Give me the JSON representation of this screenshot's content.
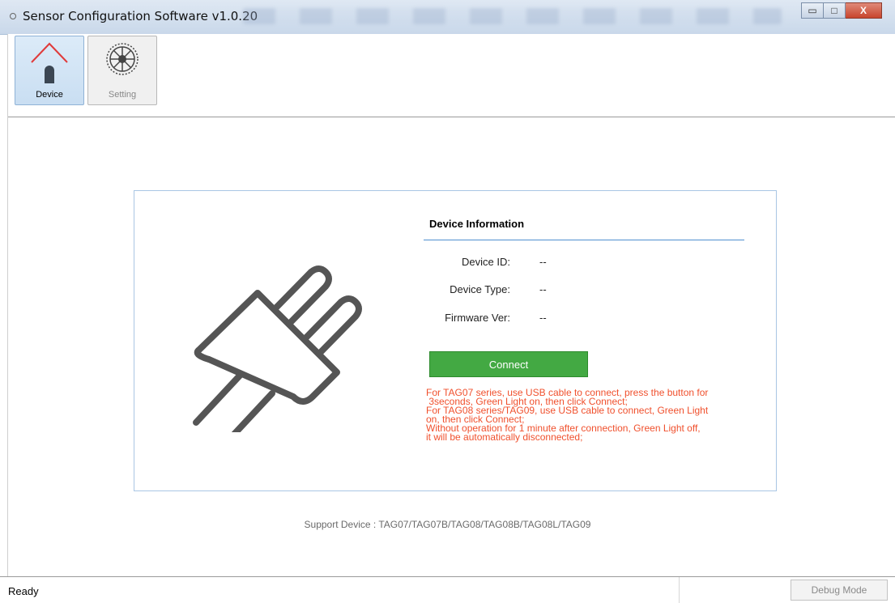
{
  "window": {
    "title": "Sensor Configuration Software v1.0.20",
    "minimize_label": "▭",
    "maximize_label": "□",
    "close_label": "X"
  },
  "toolbar": {
    "items": [
      {
        "label": "Device",
        "icon": "home-icon",
        "selected": true
      },
      {
        "label": "Setting",
        "icon": "gear-icon",
        "selected": false
      }
    ]
  },
  "device_info": {
    "title": "Device Information",
    "rows": [
      {
        "label": "Device ID:",
        "value": "--"
      },
      {
        "label": "Device Type:",
        "value": "--"
      },
      {
        "label": "Firmware Ver:",
        "value": "--"
      }
    ],
    "connect_label": "Connect",
    "notes": [
      "For TAG07 series, use USB cable to connect, press the button for",
      " 3seconds, Green Light on, then click Connect;",
      "For TAG08 series/TAG09, use USB cable to connect, Green Light",
      "on, then click Connect;",
      "Without operation for 1 minute after connection, Green Light off,",
      "it will be automatically disconnected;"
    ]
  },
  "support_text": "Support Device : TAG07/TAG07B/TAG08/TAG08B/TAG08L/TAG09",
  "status": {
    "text": "Ready",
    "debug_label": "Debug Mode"
  },
  "colors": {
    "connect_green": "#43a943",
    "note_red": "#f0502d",
    "accent_blue": "#4f8fd0"
  }
}
